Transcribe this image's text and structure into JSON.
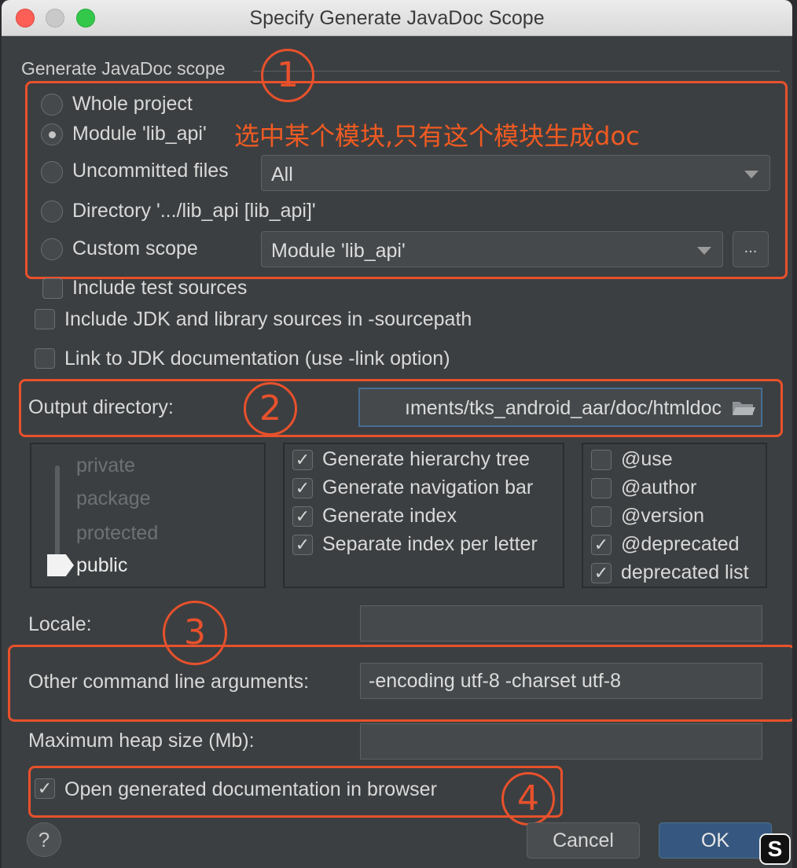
{
  "window": {
    "title": "Specify Generate JavaDoc Scope"
  },
  "scope": {
    "group_title": "Generate JavaDoc scope",
    "whole_project": "Whole project",
    "module": "Module 'lib_api'",
    "uncommitted": "Uncommitted files",
    "uncommitted_value": "All",
    "directory": "Directory '.../lib_api [lib_api]'",
    "custom": "Custom scope",
    "custom_value": "Module 'lib_api'",
    "custom_more": "...",
    "selected": "module"
  },
  "options": {
    "include_test": "Include test sources",
    "include_jdk": "Include JDK and library sources in -sourcepath",
    "link_jdk": "Link to JDK documentation (use -link option)"
  },
  "output": {
    "label": "Output directory:",
    "value": "ıments/tks_android_aar/doc/htmldoc"
  },
  "visibility": {
    "levels": [
      "private",
      "package",
      "protected",
      "public"
    ],
    "selected": "public"
  },
  "generate": {
    "items": [
      "Generate hierarchy tree",
      "Generate navigation bar",
      "Generate index",
      "Separate index per letter"
    ],
    "checked": [
      true,
      true,
      true,
      true
    ]
  },
  "tags": {
    "items": [
      "@use",
      "@author",
      "@version",
      "@deprecated",
      "deprecated list"
    ],
    "checked": [
      false,
      false,
      false,
      true,
      true
    ]
  },
  "locale": {
    "label": "Locale:",
    "value": ""
  },
  "args": {
    "label": "Other command line arguments:",
    "value": "-encoding utf-8 -charset utf-8"
  },
  "heap": {
    "label": "Maximum heap size (Mb):",
    "value": ""
  },
  "open_browser": {
    "label": "Open generated documentation in browser",
    "checked": true
  },
  "buttons": {
    "help": "?",
    "cancel": "Cancel",
    "ok": "OK"
  },
  "annotations": {
    "note": "选中某个模块,只有这个模块生成doc",
    "marker1": "1",
    "marker2": "2",
    "marker3": "3",
    "marker4": "4"
  },
  "colors": {
    "annotation": "#e8512c",
    "ok_button": "#365880",
    "dialog_bg": "#3c3f41"
  },
  "watermark": "S"
}
